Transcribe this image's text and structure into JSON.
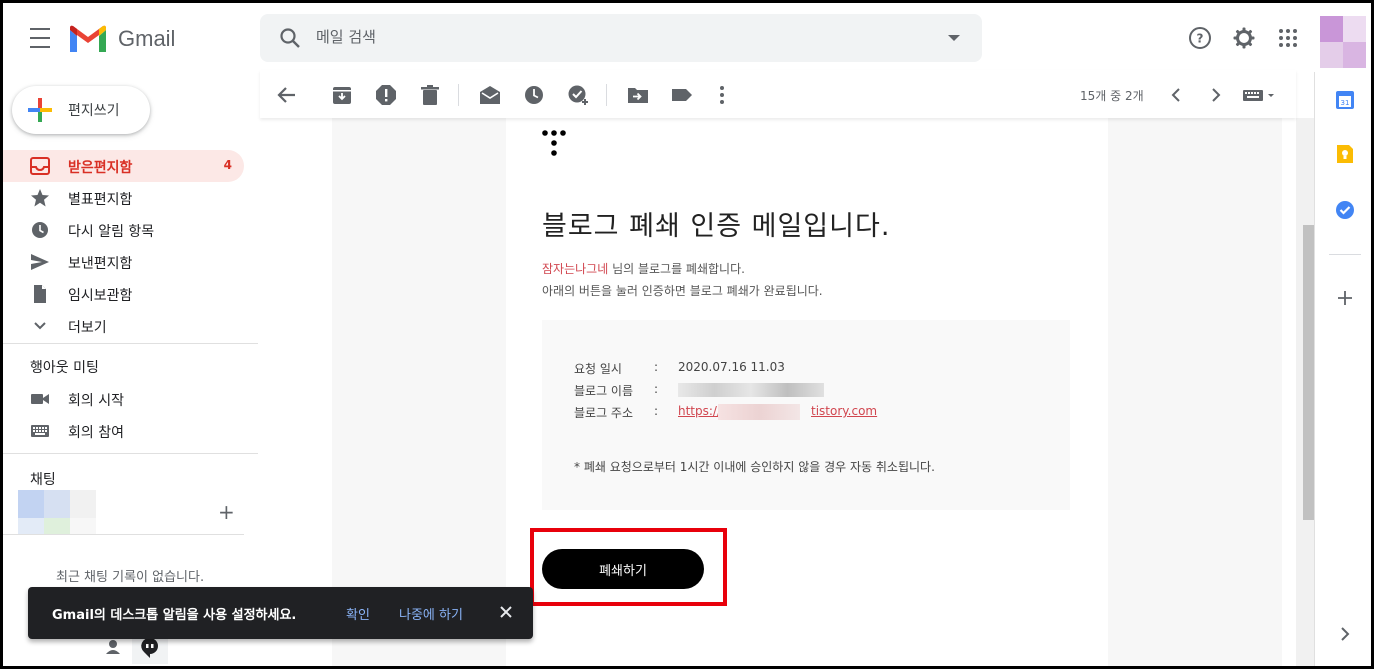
{
  "header": {
    "app_name": "Gmail",
    "search_placeholder": "메일 검색"
  },
  "sidebar": {
    "compose_label": "편지쓰기",
    "items": [
      {
        "label": "받은편지함",
        "icon": "inbox-icon",
        "count": "4",
        "active": true
      },
      {
        "label": "별표편지함",
        "icon": "star-icon"
      },
      {
        "label": "다시 알림 항목",
        "icon": "clock-icon"
      },
      {
        "label": "보낸편지함",
        "icon": "send-icon"
      },
      {
        "label": "임시보관함",
        "icon": "draft-icon"
      },
      {
        "label": "더보기",
        "icon": "chevron-down-icon"
      }
    ],
    "meet": {
      "title": "행아웃 미팅",
      "items": [
        {
          "label": "회의 시작",
          "icon": "video-camera-icon"
        },
        {
          "label": "회의 참여",
          "icon": "keyboard-icon"
        }
      ]
    },
    "chat": {
      "title": "채팅",
      "empty_text": "최근 채팅 기록이 없습니다."
    }
  },
  "toast": {
    "message": "Gmail의 데스크톱 알림을 사용 설정하세요.",
    "confirm": "확인",
    "later": "나중에 하기"
  },
  "toolbar": {
    "pager": "15개 중 2개"
  },
  "email": {
    "title": "블로그 폐쇄 인증 메일입니다.",
    "nickname": "잠자는나그네",
    "line1_rest": " 님의 블로그를 폐쇄합니다.",
    "line2": "아래의 버튼을 눌러 인증하면 블로그 폐쇄가 완료됩니다.",
    "info": {
      "request_time_label": "요청 일시",
      "request_time_value": "2020.07.16 11.03",
      "blog_name_label": "블로그 이름",
      "blog_url_label": "블로그 주소",
      "blog_url_prefix": "https://",
      "blog_url_suffix": "tistory.com",
      "colon": ":"
    },
    "notice": "* 폐쇄 요청으로부터 1시간 이내에 승인하지 않을 경우 자동 취소됩니다.",
    "button_label": "폐쇄하기"
  },
  "colors": {
    "gmail_red": "#d93025",
    "highlight": "#e8000b",
    "link": "#d1464f",
    "toast_link": "#8ab4f8"
  }
}
